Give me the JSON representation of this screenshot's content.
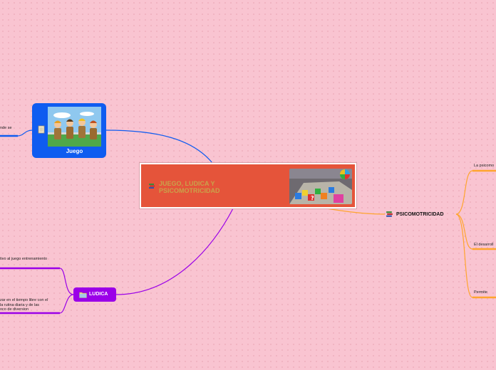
{
  "central": {
    "title": "JUEGO, LUDICA Y PSICOMOTRICIDAD",
    "image_icon": "board-game-image"
  },
  "juego": {
    "label": "Juego",
    "note_icon": "note-icon",
    "image_icon": "children-sack-race-image",
    "child_text": "nde se"
  },
  "ludica": {
    "label": "LUDICA",
    "icon": "folder-icon",
    "child_1": "tivo al juego entrenamiento",
    "child_2_lines": [
      "zar en el tiempo libre con el",
      "la rutina diaria y de las",
      "oco de diversion"
    ]
  },
  "psicomotricidad": {
    "label": "PSICOMOTRICIDAD",
    "icon": "books-icon",
    "child_1": "La psicomo",
    "child_2": "El desarroll",
    "child_3": "Permite"
  },
  "colors": {
    "background": "#f9c4d1",
    "central": "#e5543a",
    "juego": "#0f5cf0",
    "ludica": "#9b00e8",
    "psico_branch": "#ffa52e"
  }
}
